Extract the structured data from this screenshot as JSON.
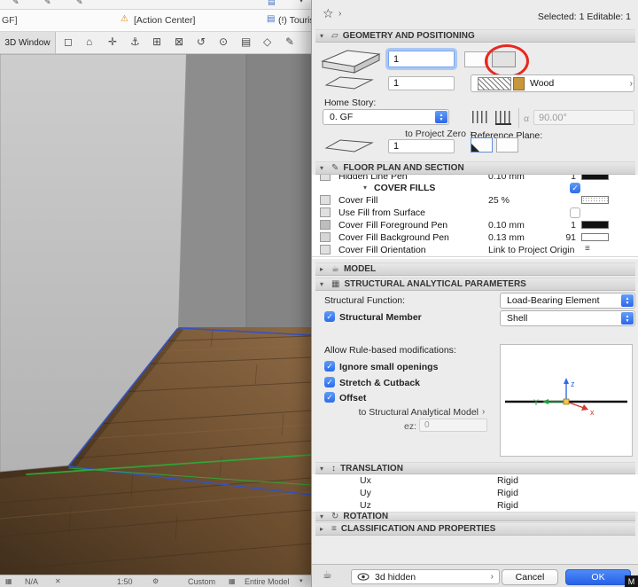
{
  "icons": {
    "star": "☆",
    "chevron": "›",
    "tri_open": "▾",
    "tri_closed": "▸",
    "alpha": "α",
    "check": "✓",
    "step_up": "▲",
    "step_down": "▼",
    "pen": "✎",
    "warning": "⚠",
    "doc": "▤",
    "translate": "↕",
    "rotate": "↻",
    "lines": "≡",
    "pot": "☕",
    "grid": "▦",
    "gear": "⚙",
    "close": "✕",
    "geometry": "▱",
    "caret_down": "▾"
  },
  "window": {
    "strips": {
      "gf": "GF]",
      "action_center": "[Action Center]",
      "notification": "(!) Touris",
      "view_tab": "3D Window"
    },
    "toolbar_icons": [
      "◻",
      "⌂",
      "✛",
      "⚓",
      "⊞",
      "⊠",
      "↺",
      "⊙",
      "▤",
      "◇",
      "✎"
    ],
    "statusbar": {
      "na": "N/A",
      "scale": "1:50",
      "custom": "Custom",
      "entire_model": "Entire Model"
    },
    "corner": "M"
  },
  "dialog": {
    "selected_info": "Selected: 1 Editable: 1",
    "geometry": {
      "title": "GEOMETRY AND POSITIONING",
      "thickness_value": "1",
      "height_value": "1",
      "base_value": "1",
      "material_label": "Wood",
      "home_story_label": "Home Story:",
      "home_story_value": "0. GF",
      "to_project_zero": "to Project Zero",
      "angle_value": "90.00°",
      "reference_plane_label": "Reference Plane:"
    },
    "floorplan": {
      "title": "FLOOR PLAN AND SECTION",
      "partial_row": {
        "label": "Hidden Line Pen",
        "value": "0.10 mm",
        "pen": "1"
      },
      "group_label": "COVER FILLS",
      "rows": [
        {
          "label": "Cover Fill",
          "value": "25 %"
        },
        {
          "label": "Use Fill from Surface",
          "value": ""
        },
        {
          "label": "Cover Fill Foreground Pen",
          "value": "0.10 mm",
          "pen": "1"
        },
        {
          "label": "Cover Fill Background Pen",
          "value": "0.13 mm",
          "pen": "91"
        },
        {
          "label": "Cover Fill Orientation",
          "value": "Link to Project Origin"
        }
      ]
    },
    "model_title": "MODEL",
    "structural": {
      "title": "STRUCTURAL ANALYTICAL PARAMETERS",
      "function_label": "Structural Function:",
      "function_value": "Load-Bearing Element",
      "member_label": "Structural Member",
      "member_value": "Shell",
      "allow_label": "Allow Rule-based modifications:",
      "checks": [
        "Ignore small openings",
        "Stretch & Cutback",
        "Offset"
      ],
      "to_sam": "to Structural Analytical Model",
      "ez_label": "ez:",
      "ez_value": "0",
      "axes": {
        "x": "x",
        "y": "Y",
        "z": "z"
      }
    },
    "translation": {
      "title": "TRANSLATION",
      "rows": [
        {
          "label": "Ux",
          "value": "Rigid"
        },
        {
          "label": "Uy",
          "value": "Rigid"
        },
        {
          "label": "Uz",
          "value": "Rigid"
        }
      ]
    },
    "rotation_title": "ROTATION",
    "classification_title": "CLASSIFICATION AND PROPERTIES",
    "footer": {
      "visibility_value": "3d hidden",
      "cancel_label": "Cancel",
      "ok_label": "OK"
    },
    "colors": {
      "accent_blue": "#2e6be6",
      "annotation_red": "#e8281e",
      "selection_green": "#2fa637",
      "selection_blue": "#3352c4"
    }
  }
}
